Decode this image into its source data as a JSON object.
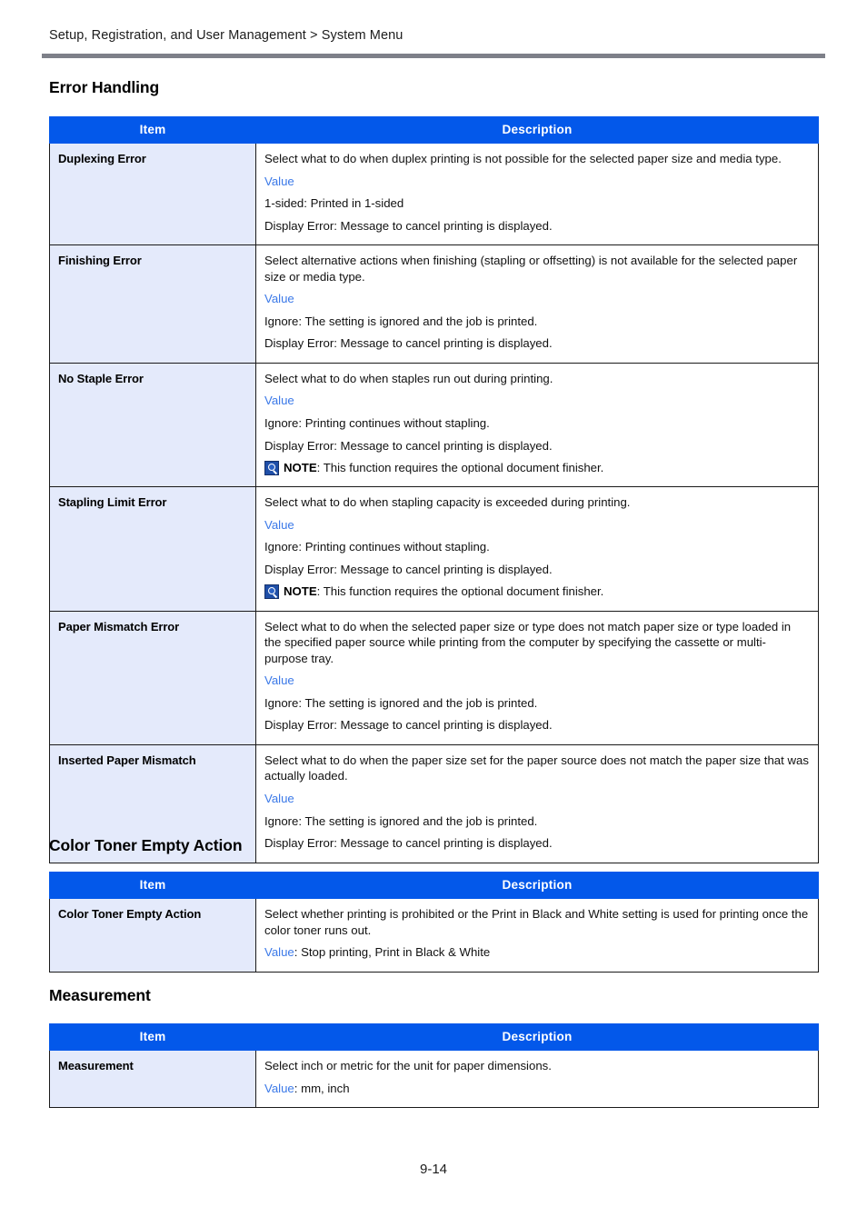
{
  "breadcrumb": "Setup, Registration, and User Management > System Menu",
  "page_number": "9-14",
  "colors": {
    "table_header_blue": "#0358ea",
    "item_cell_bg": "#e4eafb",
    "value_link_blue": "#3b79e8",
    "rule_gray": "#7e8089",
    "note_icon_blue": "#1f4fa8"
  },
  "columns": {
    "item": "Item",
    "description": "Description"
  },
  "sections": [
    {
      "id": "error-handling",
      "heading": "Error Handling",
      "rows": [
        {
          "item": "Duplexing Error",
          "lines": [
            "Select what to do when duplex printing is not possible for the selected paper size and media type.",
            "1-sided: Printed in 1-sided",
            "Display Error: Message to cancel printing is displayed."
          ],
          "value_label": "Value"
        },
        {
          "item": "Finishing Error",
          "lines": [
            "Select alternative actions when finishing (stapling or offsetting) is not available for the selected paper size or media type.",
            "Ignore: The setting is ignored and the job is printed.",
            "Display Error: Message to cancel printing is displayed."
          ],
          "value_label": "Value"
        },
        {
          "item": "No Staple Error",
          "lines": [
            "Select what to do when staples run out during printing.",
            "Ignore: Printing continues without stapling.",
            "Display Error: Message to cancel printing is displayed."
          ],
          "value_label": "Value",
          "note_word": "NOTE",
          "note_text": ": This function requires the optional document finisher."
        },
        {
          "item": "Stapling Limit Error",
          "lines": [
            "Select what to do when stapling capacity is exceeded during printing.",
            "Ignore: Printing continues without stapling.",
            "Display Error: Message to cancel printing is displayed."
          ],
          "value_label": "Value",
          "note_word": "NOTE",
          "note_text": ": This function requires the optional document finisher."
        },
        {
          "item": "Paper Mismatch Error",
          "lines": [
            "Select what to do when the selected paper size or type does not match paper size or type loaded in the specified paper source while printing from the computer by specifying the cassette or multi-purpose tray.",
            "Ignore: The setting is ignored and the job is printed.",
            "Display Error: Message to cancel printing is displayed."
          ],
          "value_label": "Value"
        },
        {
          "item": "Inserted Paper Mismatch",
          "lines": [
            "Select what to do when the paper size set for the paper source does not match the paper size that was actually loaded.",
            "Ignore: The setting is ignored and the job is printed.",
            "Display Error: Message to cancel printing is displayed."
          ],
          "value_label": "Value"
        }
      ]
    },
    {
      "id": "color-toner",
      "heading": "Color Toner Empty Action",
      "rows": [
        {
          "item": "Color Toner Empty Action",
          "intro": "Select whether printing is prohibited or the Print in Black and White setting is used for printing once the color toner runs out.",
          "value_label": "Value",
          "value_suffix": ": Stop printing, Print in Black & White"
        }
      ]
    },
    {
      "id": "measurement",
      "heading": "Measurement",
      "rows": [
        {
          "item": "Measurement",
          "intro": "Select inch or metric for the unit for paper dimensions.",
          "value_label": "Value",
          "value_suffix": ": mm, inch"
        }
      ]
    }
  ]
}
